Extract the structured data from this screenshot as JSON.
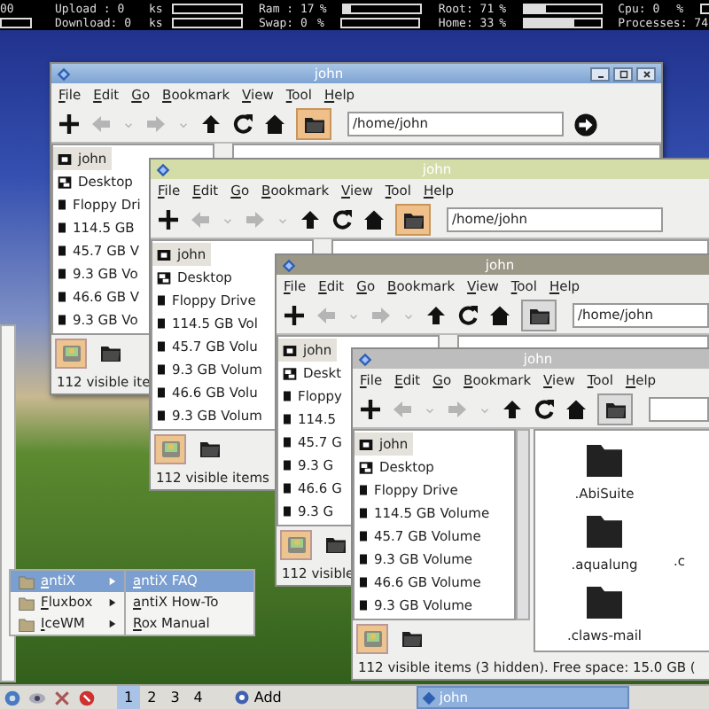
{
  "conky": {
    "columns": [
      {
        "rows": [
          {
            "text": "00"
          },
          {
            "level": 0
          }
        ]
      },
      {
        "rows": [
          {
            "text": "Upload : 0",
            "unit": "ks",
            "level": 0
          },
          {
            "text": "Download: 0",
            "unit": "ks",
            "level": 0
          }
        ]
      },
      {
        "rows": [
          {
            "text": "Ram : 17",
            "unit": "%",
            "level": 0.08
          },
          {
            "text": "Swap: 0",
            "unit": "%",
            "level": 0
          }
        ]
      },
      {
        "rows": [
          {
            "text": "Root: 71",
            "unit": "%",
            "level": 0.28
          },
          {
            "text": "Home: 33",
            "unit": "%",
            "level": 0.65
          }
        ]
      },
      {
        "rows": [
          {
            "text": "Cpu:  0",
            "unit": "%",
            "level": 0
          },
          {
            "text": "Processes: 74"
          }
        ]
      }
    ]
  },
  "windows": [
    {
      "title": "john",
      "active": true,
      "has_controls": true,
      "menu": [
        "File",
        "Edit",
        "Go",
        "Bookmark",
        "View",
        "Tool",
        "Help"
      ],
      "toolbar": [
        {
          "kind": "new",
          "disabled": false
        },
        {
          "kind": "back",
          "disabled": true
        },
        {
          "kind": "caret",
          "disabled": true
        },
        {
          "kind": "forward",
          "disabled": true
        },
        {
          "kind": "caret",
          "disabled": true
        },
        {
          "kind": "up",
          "disabled": false
        },
        {
          "kind": "refresh",
          "disabled": false
        },
        {
          "kind": "home",
          "disabled": false
        },
        {
          "kind": "folder",
          "highlighted": true
        }
      ],
      "path": "/home/john",
      "has_go": true,
      "places": [
        {
          "kind": "home",
          "label": "john",
          "selected": true
        },
        {
          "kind": "desktop",
          "label": "Desktop",
          "selected": false
        },
        {
          "kind": "drive",
          "label": "Floppy Dri",
          "selected": false
        },
        {
          "kind": "drive",
          "label": "114.5 GB",
          "selected": false
        },
        {
          "kind": "drive",
          "label": "45.7 GB V",
          "selected": false
        },
        {
          "kind": "drive",
          "label": "9.3 GB Vo",
          "selected": false
        },
        {
          "kind": "drive",
          "label": "46.6 GB V",
          "selected": false
        },
        {
          "kind": "drive",
          "label": "9.3 GB Vo",
          "selected": false
        }
      ],
      "panel_buttons": [
        {
          "kind": "disk",
          "pressed": true
        },
        {
          "kind": "folder",
          "pressed": false
        }
      ],
      "status": "112 visible ite"
    },
    {
      "title": "john",
      "active": false,
      "menu": [
        "File",
        "Edit",
        "Go",
        "Bookmark",
        "View",
        "Tool",
        "Help"
      ],
      "toolbar": [
        {
          "kind": "new",
          "disabled": false
        },
        {
          "kind": "back",
          "disabled": true
        },
        {
          "kind": "caret",
          "disabled": true
        },
        {
          "kind": "forward",
          "disabled": true
        },
        {
          "kind": "caret",
          "disabled": true
        },
        {
          "kind": "up",
          "disabled": false
        },
        {
          "kind": "refresh",
          "disabled": false
        },
        {
          "kind": "home",
          "disabled": false
        },
        {
          "kind": "folder",
          "highlighted": true
        }
      ],
      "path": "/home/john",
      "places": [
        {
          "kind": "home",
          "label": "john",
          "selected": true
        },
        {
          "kind": "desktop",
          "label": "Desktop",
          "selected": false
        },
        {
          "kind": "drive",
          "label": "Floppy Drive",
          "selected": false
        },
        {
          "kind": "drive",
          "label": "114.5 GB Vol",
          "selected": false
        },
        {
          "kind": "drive",
          "label": "45.7 GB Volu",
          "selected": false
        },
        {
          "kind": "drive",
          "label": "9.3 GB Volum",
          "selected": false
        },
        {
          "kind": "drive",
          "label": "46.6 GB Volu",
          "selected": false
        },
        {
          "kind": "drive",
          "label": "9.3 GB Volum",
          "selected": false
        }
      ],
      "panel_buttons": [
        {
          "kind": "disk",
          "pressed": true
        },
        {
          "kind": "folder",
          "pressed": false
        }
      ],
      "status": "112 visible items"
    },
    {
      "title": "john",
      "active": false,
      "menu": [
        "File",
        "Edit",
        "Go",
        "Bookmark",
        "View",
        "Tool",
        "Help"
      ],
      "toolbar": [
        {
          "kind": "new",
          "disabled": false
        },
        {
          "kind": "back",
          "disabled": true
        },
        {
          "kind": "caret",
          "disabled": true
        },
        {
          "kind": "forward",
          "disabled": true
        },
        {
          "kind": "caret",
          "disabled": true
        },
        {
          "kind": "up",
          "disabled": false
        },
        {
          "kind": "refresh",
          "disabled": false
        },
        {
          "kind": "home",
          "disabled": false
        },
        {
          "kind": "folder",
          "highlighted": false
        }
      ],
      "path": "/home/john",
      "places": [
        {
          "kind": "home",
          "label": "john",
          "selected": true
        },
        {
          "kind": "desktop",
          "label": "Deskt",
          "selected": false
        },
        {
          "kind": "drive",
          "label": "Floppy",
          "selected": false
        },
        {
          "kind": "drive",
          "label": "114.5",
          "selected": false
        },
        {
          "kind": "drive",
          "label": "45.7 G",
          "selected": false
        },
        {
          "kind": "drive",
          "label": "9.3 G",
          "selected": false
        },
        {
          "kind": "drive",
          "label": "46.6 G",
          "selected": false
        },
        {
          "kind": "drive",
          "label": "9.3 G",
          "selected": false
        }
      ],
      "panel_buttons": [
        {
          "kind": "disk",
          "pressed": true
        },
        {
          "kind": "folder",
          "pressed": false
        }
      ],
      "status": "112 visible"
    },
    {
      "title": "john",
      "active": false,
      "menu": [
        "File",
        "Edit",
        "Go",
        "Bookmark",
        "View",
        "Tool",
        "Help"
      ],
      "toolbar": [
        {
          "kind": "new",
          "disabled": false
        },
        {
          "kind": "back",
          "disabled": true
        },
        {
          "kind": "caret",
          "disabled": true
        },
        {
          "kind": "forward",
          "disabled": true
        },
        {
          "kind": "caret",
          "disabled": true
        },
        {
          "kind": "up",
          "disabled": false
        },
        {
          "kind": "refresh",
          "disabled": false
        },
        {
          "kind": "home",
          "disabled": false
        },
        {
          "kind": "folder",
          "highlighted": false
        }
      ],
      "places": [
        {
          "kind": "home",
          "label": "john",
          "selected": true
        },
        {
          "kind": "desktop",
          "label": "Desktop",
          "selected": false
        },
        {
          "kind": "drive",
          "label": "Floppy Drive",
          "selected": false
        },
        {
          "kind": "drive",
          "label": "114.5 GB Volume",
          "selected": false
        },
        {
          "kind": "drive",
          "label": "45.7 GB Volume",
          "selected": false
        },
        {
          "kind": "drive",
          "label": "9.3 GB Volume",
          "selected": false
        },
        {
          "kind": "drive",
          "label": "46.6 GB Volume",
          "selected": false
        },
        {
          "kind": "drive",
          "label": "9.3 GB Volume",
          "selected": false
        }
      ],
      "panel_buttons": [
        {
          "kind": "disk",
          "pressed": true
        },
        {
          "kind": "folder",
          "pressed": false
        }
      ],
      "file_rows": [
        {
          "cells": [
            {
              "name": ".AbiSuite"
            }
          ]
        },
        {
          "cells": [
            {
              "name": ".aqualung"
            },
            {
              "name": ".c"
            }
          ]
        },
        {
          "cells": [
            {
              "name": ".claws-mail"
            }
          ]
        }
      ],
      "status": "112 visible items (3 hidden). Free space: 15.0 GB ("
    }
  ],
  "submenu": [
    {
      "label": "antiX",
      "selected": true
    },
    {
      "label": "Fluxbox",
      "selected": false
    },
    {
      "label": "IceWM",
      "selected": false
    }
  ],
  "subsubmenu": [
    {
      "label": "antiX FAQ",
      "selected": true
    },
    {
      "label": "antiX How-To",
      "selected": false
    },
    {
      "label": "Rox Manual",
      "selected": false
    }
  ],
  "taskbar": {
    "launchers": [
      {
        "kind": "network"
      },
      {
        "kind": "eye"
      },
      {
        "kind": "tools"
      },
      {
        "kind": "stop"
      }
    ],
    "workspaces": [
      {
        "label": "1",
        "selected": true
      },
      {
        "label": "2",
        "selected": false
      },
      {
        "label": "3",
        "selected": false
      },
      {
        "label": "4",
        "selected": false
      }
    ],
    "add_label": "Add",
    "tasks": [
      {
        "label": "john",
        "selected": true
      }
    ]
  }
}
